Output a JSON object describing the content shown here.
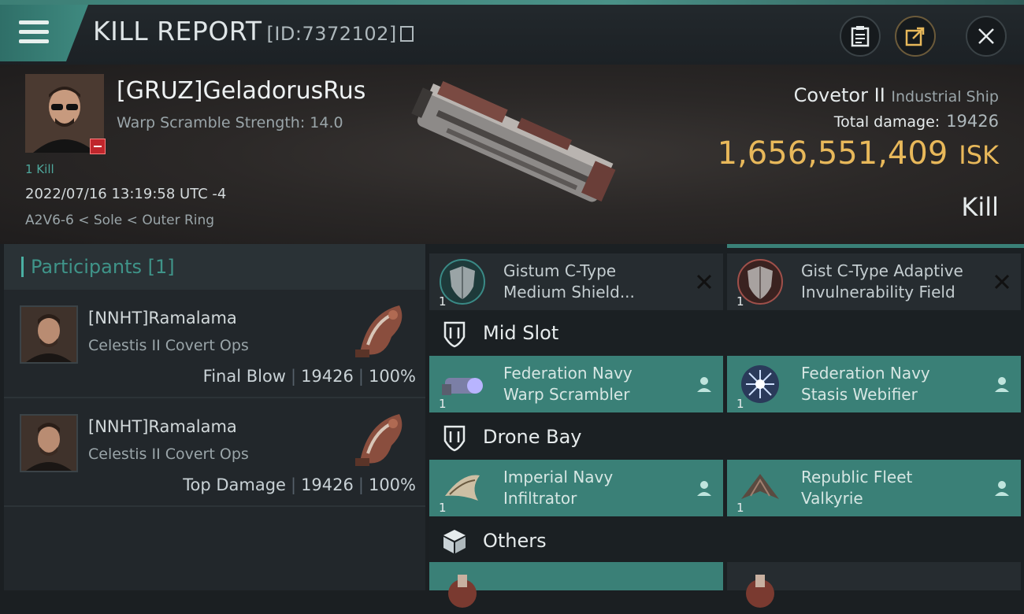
{
  "header": {
    "title": "KILL REPORT",
    "id_label": "[ID:7372102]"
  },
  "victim": {
    "name": "[GRUZ]GeladorusRus",
    "warp_scramble": "Warp Scramble Strength: 14.0",
    "kills": "1 Kill",
    "datetime": "2022/07/16 13:19:58 UTC -4",
    "location": "A2V6-6 < Sole < Outer Ring",
    "ship_name": "Covetor II",
    "ship_class": "Industrial Ship",
    "total_damage_label": "Total damage:",
    "total_damage": "19426",
    "isk_value": "1,656,551,409",
    "isk_unit": "ISK",
    "outcome": "Kill"
  },
  "participants": {
    "header": "Participants",
    "count": "[1]",
    "rows": [
      {
        "name": "[NNHT]Ramalama",
        "ship": "Celestis II Covert Ops",
        "role": "Final Blow",
        "damage": "19426",
        "percent": "100%"
      },
      {
        "name": "[NNHT]Ramalama",
        "ship": "Celestis II Covert Ops",
        "role": "Top Damage",
        "damage": "19426",
        "percent": "100%"
      }
    ]
  },
  "fitting": {
    "low_items": [
      {
        "qty": "1",
        "line1": "Gistum C-Type",
        "line2": "Medium Shield..."
      },
      {
        "qty": "1",
        "line1": "Gist C-Type Adaptive",
        "line2": "Invulnerability Field"
      }
    ],
    "mid_slot_label": "Mid Slot",
    "mid_items": [
      {
        "qty": "1",
        "line1": "Federation Navy",
        "line2": "Warp Scrambler"
      },
      {
        "qty": "1",
        "line1": "Federation Navy",
        "line2": "Stasis Webifier"
      }
    ],
    "drone_bay_label": "Drone Bay",
    "drone_items": [
      {
        "qty": "1",
        "line1": "Imperial Navy",
        "line2": "Infiltrator"
      },
      {
        "qty": "1",
        "line1": "Republic Fleet",
        "line2": "Valkyrie"
      }
    ],
    "others_label": "Others"
  },
  "colors": {
    "accent_teal": "#3a8077",
    "isk_gold": "#e8b85a",
    "badge_red": "#c0262c"
  }
}
